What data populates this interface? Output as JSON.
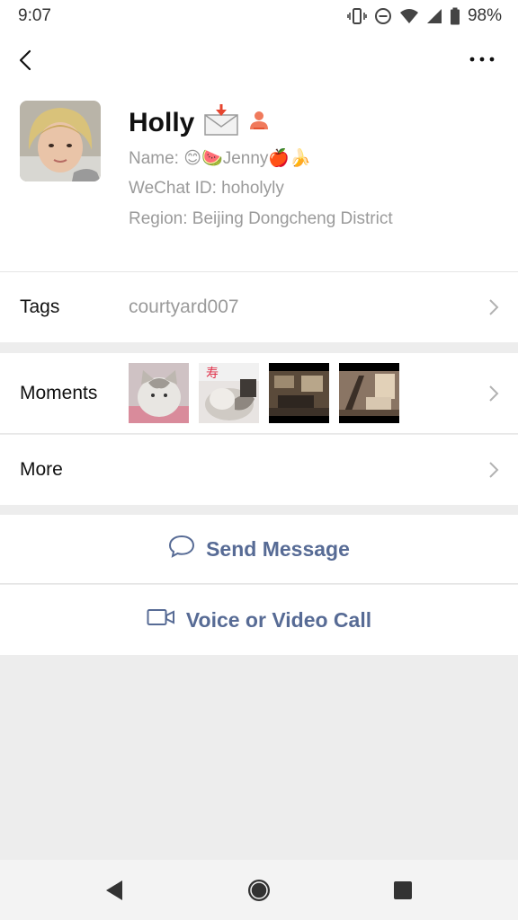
{
  "status": {
    "time": "9:07",
    "battery": "98%"
  },
  "profile": {
    "name": "Holly",
    "name_line": "Name:  😊🍉Jenny🍎🍌",
    "wechat_line": "WeChat ID:  hoholyly",
    "region_line": "Region:  Beijing  Dongcheng District"
  },
  "tags": {
    "label": "Tags",
    "value": "courtyard007"
  },
  "moments": {
    "label": "Moments"
  },
  "more": {
    "label": "More"
  },
  "actions": {
    "send": "Send Message",
    "call": "Voice or Video Call"
  },
  "colors": {
    "link": "#576b95",
    "background": "#ededed",
    "accent": "#f04f36"
  },
  "icons": [
    "back-arrow-icon",
    "more-dots-icon",
    "chat-bubble-icon",
    "video-camera-icon",
    "chevron-right-icon"
  ]
}
